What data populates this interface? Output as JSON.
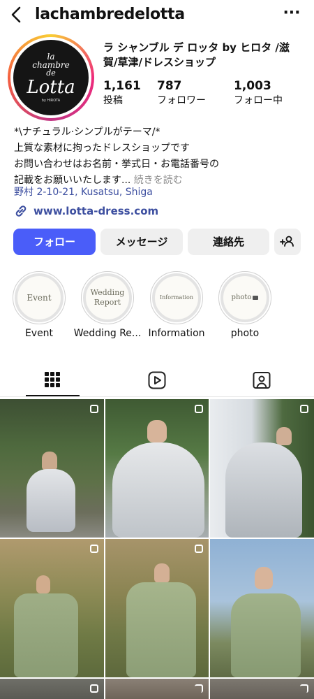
{
  "header": {
    "username": "lachambredelotta",
    "more_glyph": "···"
  },
  "profile": {
    "name_lines": [
      "ラ シャンブル デ ロッタ by ヒロタ /滋",
      "賀/草津/ドレスショップ"
    ],
    "logo": {
      "line1": "la",
      "line2": "chambre",
      "line3": "de",
      "main": "Lotta",
      "sub": "by HIROTA"
    },
    "stats": [
      {
        "value": "1,161",
        "label": "投稿"
      },
      {
        "value": "787",
        "label": "フォロワー"
      },
      {
        "value": "1,003",
        "label": "フォロー中"
      }
    ],
    "bio": {
      "line1": "*\\ナチュラル·シンプルがテーマ/*",
      "line2": "上質な素材に拘ったドレスショップです",
      "line3": "お問い合わせはお名前・挙式日・お電話番号の",
      "line4_main": "記載をお願いいたします...",
      "line4_more": " 続きを読む",
      "location": "野村 2-10-21, Kusatsu, Shiga",
      "website": "www.lotta-dress.com"
    }
  },
  "buttons": {
    "follow": "フォロー",
    "message": "メッセージ",
    "contact": "連絡先"
  },
  "highlights": [
    {
      "cover_text": "Event",
      "label": "Event"
    },
    {
      "cover_text_1": "Wedding",
      "cover_text_2": "Report",
      "label": "Wedding Re..."
    },
    {
      "cover_text": "Information",
      "label": "Information"
    },
    {
      "cover_text": "photo",
      "label": "photo"
    }
  ],
  "tabs": [
    "grid-tab",
    "reels-tab",
    "tagged-tab"
  ],
  "colors": {
    "accent": "#4a5df9",
    "link": "#3d4fa0",
    "story_ring": [
      "#f9ce34",
      "#ee2a7b",
      "#c13584",
      "#f56040"
    ]
  },
  "grid_posts": [
    {
      "subject": "woman in gray-white ruffled gown in garden",
      "multi": true
    },
    {
      "subject": "woman in gray tulle gown sitting in greenery",
      "multi": true
    },
    {
      "subject": "woman in gray ruffled gown by white building",
      "multi": true
    },
    {
      "subject": "woman in sage green gown in bamboo grass",
      "multi": true
    },
    {
      "subject": "woman in sage green gown with puff sleeves",
      "multi": true
    },
    {
      "subject": "woman in sage green gown, blue sky",
      "multi": false
    }
  ]
}
